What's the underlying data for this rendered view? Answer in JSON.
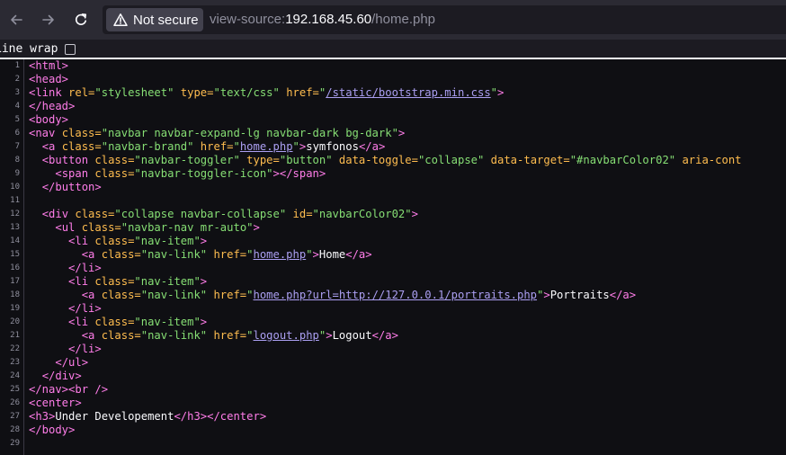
{
  "toolbar": {
    "back_icon": "arrow-left-icon",
    "forward_icon": "arrow-right-icon",
    "reload_icon": "reload-icon",
    "security_label": "Not secure",
    "url_prefix": "view-source:",
    "url_host": "192.168.45.60",
    "url_path": "/home.php"
  },
  "view_source": {
    "wrap_label": "Line wrap",
    "lines": [
      {
        "n": "1",
        "parts": [
          [
            "t",
            "<html>"
          ]
        ]
      },
      {
        "n": "2",
        "parts": [
          [
            "t",
            "<head>"
          ]
        ]
      },
      {
        "n": "3",
        "parts": [
          [
            "t",
            "<link "
          ],
          [
            "a",
            "rel="
          ],
          [
            "v",
            "\"stylesheet\""
          ],
          [
            "a",
            " type="
          ],
          [
            "v",
            "\"text/css\""
          ],
          [
            "a",
            " href="
          ],
          [
            "v",
            "\""
          ],
          [
            "l",
            "/static/bootstrap.min.css"
          ],
          [
            "v",
            "\""
          ],
          [
            "t",
            ">"
          ]
        ]
      },
      {
        "n": "4",
        "parts": [
          [
            "t",
            "</head>"
          ]
        ]
      },
      {
        "n": "5",
        "parts": [
          [
            "t",
            "<body>"
          ]
        ]
      },
      {
        "n": "6",
        "parts": [
          [
            "t",
            "<nav "
          ],
          [
            "a",
            "class="
          ],
          [
            "v",
            "\"navbar navbar-expand-lg navbar-dark bg-dark\""
          ],
          [
            "t",
            ">"
          ]
        ]
      },
      {
        "n": "7",
        "parts": [
          [
            "x",
            "  "
          ],
          [
            "t",
            "<a "
          ],
          [
            "a",
            "class="
          ],
          [
            "v",
            "\"navbar-brand\""
          ],
          [
            "a",
            " href="
          ],
          [
            "v",
            "\""
          ],
          [
            "l",
            "home.php"
          ],
          [
            "v",
            "\""
          ],
          [
            "t",
            ">"
          ],
          [
            "x",
            "symfonos"
          ],
          [
            "t",
            "</a>"
          ]
        ]
      },
      {
        "n": "8",
        "parts": [
          [
            "x",
            "  "
          ],
          [
            "t",
            "<button "
          ],
          [
            "a",
            "class="
          ],
          [
            "v",
            "\"navbar-toggler\""
          ],
          [
            "a",
            " type="
          ],
          [
            "v",
            "\"button\""
          ],
          [
            "a",
            " data-toggle="
          ],
          [
            "v",
            "\"collapse\""
          ],
          [
            "a",
            " data-target="
          ],
          [
            "v",
            "\"#navbarColor02\""
          ],
          [
            "a",
            " aria-cont"
          ]
        ]
      },
      {
        "n": "9",
        "parts": [
          [
            "x",
            "    "
          ],
          [
            "t",
            "<span "
          ],
          [
            "a",
            "class="
          ],
          [
            "v",
            "\"navbar-toggler-icon\""
          ],
          [
            "t",
            "></span>"
          ]
        ]
      },
      {
        "n": "10",
        "parts": [
          [
            "x",
            "  "
          ],
          [
            "t",
            "</button>"
          ]
        ]
      },
      {
        "n": "11",
        "parts": []
      },
      {
        "n": "12",
        "parts": [
          [
            "x",
            "  "
          ],
          [
            "t",
            "<div "
          ],
          [
            "a",
            "class="
          ],
          [
            "v",
            "\"collapse navbar-collapse\""
          ],
          [
            "a",
            " id="
          ],
          [
            "v",
            "\"navbarColor02\""
          ],
          [
            "t",
            ">"
          ]
        ]
      },
      {
        "n": "13",
        "parts": [
          [
            "x",
            "    "
          ],
          [
            "t",
            "<ul "
          ],
          [
            "a",
            "class="
          ],
          [
            "v",
            "\"navbar-nav mr-auto\""
          ],
          [
            "t",
            ">"
          ]
        ]
      },
      {
        "n": "14",
        "parts": [
          [
            "x",
            "      "
          ],
          [
            "t",
            "<li "
          ],
          [
            "a",
            "class="
          ],
          [
            "v",
            "\"nav-item\""
          ],
          [
            "t",
            ">"
          ]
        ]
      },
      {
        "n": "15",
        "parts": [
          [
            "x",
            "        "
          ],
          [
            "t",
            "<a "
          ],
          [
            "a",
            "class="
          ],
          [
            "v",
            "\"nav-link\""
          ],
          [
            "a",
            " href="
          ],
          [
            "v",
            "\""
          ],
          [
            "l",
            "home.php"
          ],
          [
            "v",
            "\""
          ],
          [
            "t",
            ">"
          ],
          [
            "x",
            "Home"
          ],
          [
            "t",
            "</a>"
          ]
        ]
      },
      {
        "n": "16",
        "parts": [
          [
            "x",
            "      "
          ],
          [
            "t",
            "</li>"
          ]
        ]
      },
      {
        "n": "17",
        "parts": [
          [
            "x",
            "      "
          ],
          [
            "t",
            "<li "
          ],
          [
            "a",
            "class="
          ],
          [
            "v",
            "\"nav-item\""
          ],
          [
            "t",
            ">"
          ]
        ]
      },
      {
        "n": "18",
        "parts": [
          [
            "x",
            "        "
          ],
          [
            "t",
            "<a "
          ],
          [
            "a",
            "class="
          ],
          [
            "v",
            "\"nav-link\""
          ],
          [
            "a",
            " href="
          ],
          [
            "v",
            "\""
          ],
          [
            "l",
            "home.php?url=http://127.0.0.1/portraits.php"
          ],
          [
            "v",
            "\""
          ],
          [
            "t",
            ">"
          ],
          [
            "x",
            "Portraits"
          ],
          [
            "t",
            "</a>"
          ]
        ]
      },
      {
        "n": "19",
        "parts": [
          [
            "x",
            "      "
          ],
          [
            "t",
            "</li>"
          ]
        ]
      },
      {
        "n": "20",
        "parts": [
          [
            "x",
            "      "
          ],
          [
            "t",
            "<li "
          ],
          [
            "a",
            "class="
          ],
          [
            "v",
            "\"nav-item\""
          ],
          [
            "t",
            ">"
          ]
        ]
      },
      {
        "n": "21",
        "parts": [
          [
            "x",
            "        "
          ],
          [
            "t",
            "<a "
          ],
          [
            "a",
            "class="
          ],
          [
            "v",
            "\"nav-link\""
          ],
          [
            "a",
            " href="
          ],
          [
            "v",
            "\""
          ],
          [
            "l",
            "logout.php"
          ],
          [
            "v",
            "\""
          ],
          [
            "t",
            ">"
          ],
          [
            "x",
            "Logout"
          ],
          [
            "t",
            "</a>"
          ]
        ]
      },
      {
        "n": "22",
        "parts": [
          [
            "x",
            "      "
          ],
          [
            "t",
            "</li>"
          ]
        ]
      },
      {
        "n": "23",
        "parts": [
          [
            "x",
            "    "
          ],
          [
            "t",
            "</ul>"
          ]
        ]
      },
      {
        "n": "24",
        "parts": [
          [
            "x",
            "  "
          ],
          [
            "t",
            "</div>"
          ]
        ]
      },
      {
        "n": "25",
        "parts": [
          [
            "t",
            "</nav><br />"
          ]
        ]
      },
      {
        "n": "26",
        "parts": [
          [
            "t",
            "<center>"
          ]
        ]
      },
      {
        "n": "27",
        "parts": [
          [
            "t",
            "<h3>"
          ],
          [
            "x",
            "Under Developement"
          ],
          [
            "t",
            "</h3></center>"
          ]
        ]
      },
      {
        "n": "28",
        "parts": [
          [
            "t",
            "</body>"
          ]
        ]
      },
      {
        "n": "29",
        "parts": []
      }
    ]
  },
  "colors": {
    "chrome_bg": "#2b2a33",
    "source_bg": "#0f0f13",
    "tag": "#ff7de9",
    "attribute": "#ffbd4f",
    "value": "#86de74",
    "link": "#ab9ff2",
    "text": "#fbfbfe"
  }
}
